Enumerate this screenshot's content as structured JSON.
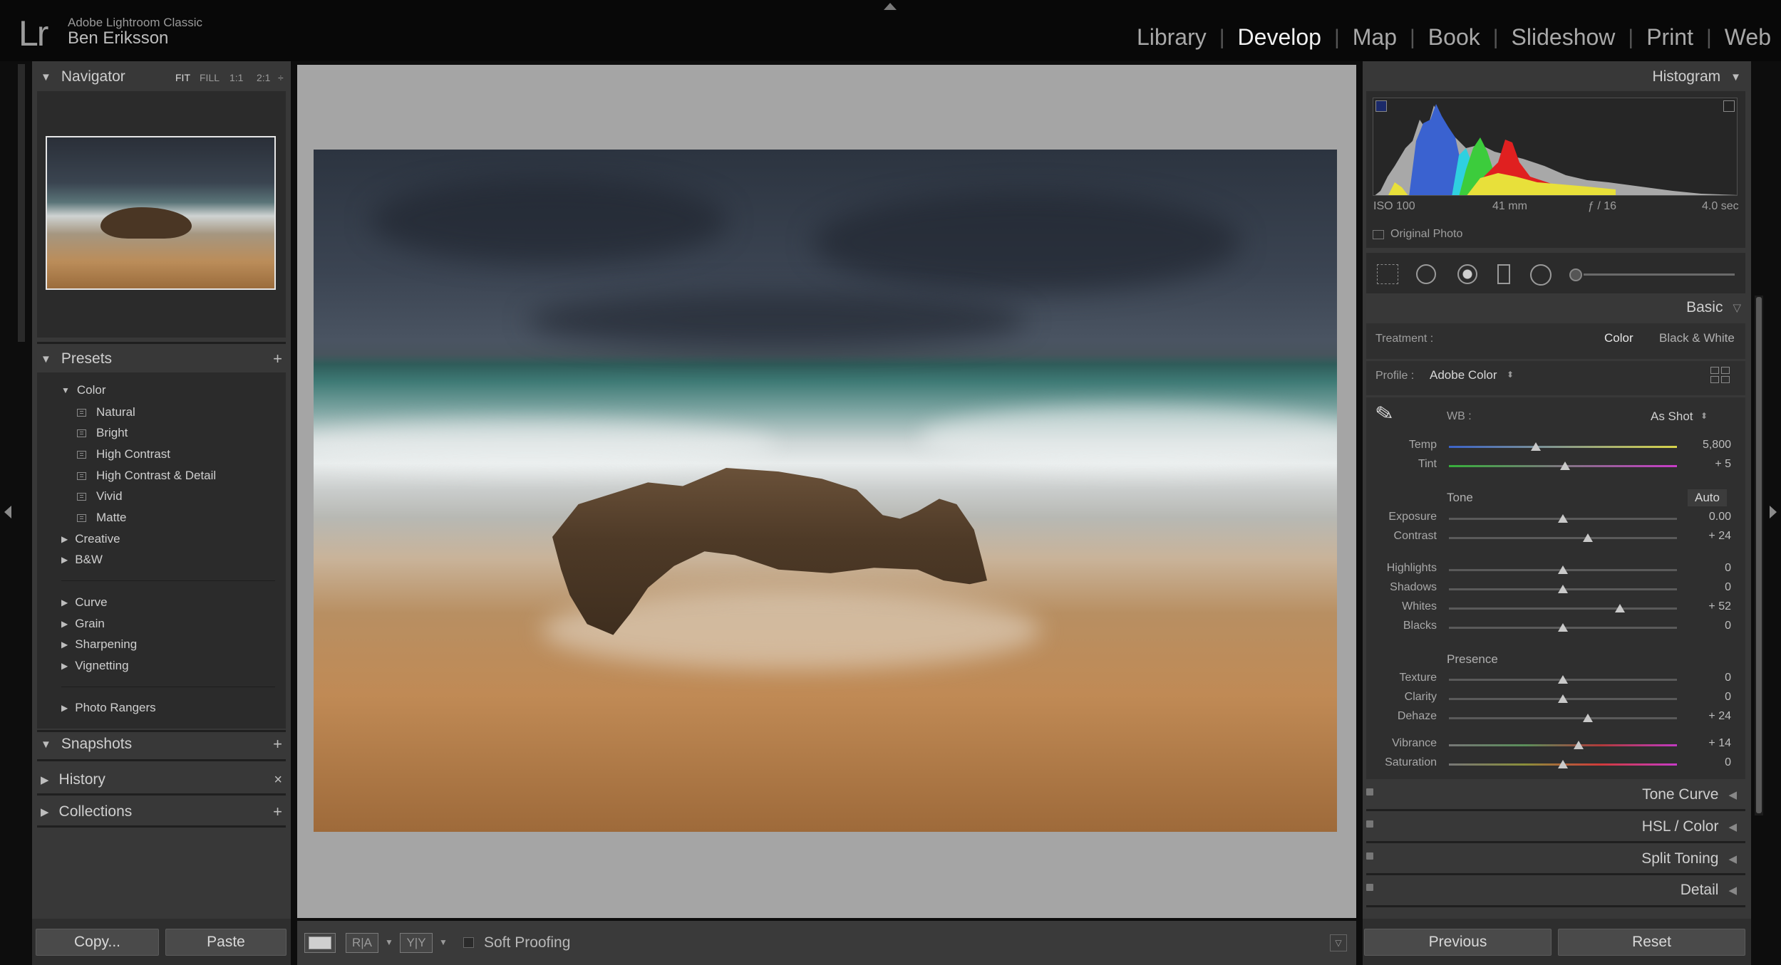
{
  "app": {
    "logo": "Lr",
    "name": "Adobe Lightroom Classic",
    "user": "Ben Eriksson"
  },
  "modules": [
    "Library",
    "Develop",
    "Map",
    "Book",
    "Slideshow",
    "Print",
    "Web"
  ],
  "active_module": "Develop",
  "navigator": {
    "title": "Navigator",
    "zoom_options": [
      "FIT",
      "FILL",
      "1:1",
      "2:1"
    ],
    "zoom_arrow": "÷"
  },
  "presets": {
    "title": "Presets",
    "add": "+",
    "color_group": "Color",
    "color_items": [
      "Natural",
      "Bright",
      "High Contrast",
      "High Contrast & Detail",
      "Vivid",
      "Matte"
    ],
    "groups_a": [
      "Creative",
      "B&W"
    ],
    "groups_b": [
      "Curve",
      "Grain",
      "Sharpening",
      "Vignetting"
    ],
    "groups_c": [
      "Photo Rangers"
    ]
  },
  "snapshots": {
    "title": "Snapshots",
    "action": "+"
  },
  "history": {
    "title": "History",
    "action": "×"
  },
  "collections": {
    "title": "Collections",
    "action": "+"
  },
  "left_buttons": {
    "copy": "Copy...",
    "paste": "Paste"
  },
  "toolbar": {
    "soft_proofing": "Soft Proofing",
    "ra_label": "R|A",
    "yy_label": "Y|Y"
  },
  "histogram": {
    "title": "Histogram",
    "iso": "ISO 100",
    "focal": "41 mm",
    "aperture": "ƒ / 16",
    "shutter": "4.0 sec",
    "original_photo": "Original Photo"
  },
  "basic": {
    "title": "Basic",
    "treatment_label": "Treatment :",
    "treatment_color": "Color",
    "treatment_bw": "Black & White",
    "profile_label": "Profile :",
    "profile_value": "Adobe Color",
    "wb_label": "WB :",
    "wb_value": "As Shot",
    "tone_label": "Tone",
    "auto_label": "Auto",
    "presence_label": "Presence",
    "sliders": [
      {
        "label": "Temp",
        "value": "5,800",
        "pos": 0.38
      },
      {
        "label": "Tint",
        "value": "+ 5",
        "pos": 0.51
      },
      {
        "label": "Exposure",
        "value": "0.00",
        "pos": 0.5
      },
      {
        "label": "Contrast",
        "value": "+ 24",
        "pos": 0.61
      },
      {
        "label": "Highlights",
        "value": "0",
        "pos": 0.5
      },
      {
        "label": "Shadows",
        "value": "0",
        "pos": 0.5
      },
      {
        "label": "Whites",
        "value": "+ 52",
        "pos": 0.75
      },
      {
        "label": "Blacks",
        "value": "0",
        "pos": 0.5
      },
      {
        "label": "Texture",
        "value": "0",
        "pos": 0.5
      },
      {
        "label": "Clarity",
        "value": "0",
        "pos": 0.5
      },
      {
        "label": "Dehaze",
        "value": "+ 24",
        "pos": 0.61
      },
      {
        "label": "Vibrance",
        "value": "+ 14",
        "pos": 0.57
      },
      {
        "label": "Saturation",
        "value": "0",
        "pos": 0.5
      }
    ]
  },
  "right_sections": [
    "Tone Curve",
    "HSL / Color",
    "Split Toning",
    "Detail"
  ],
  "right_buttons": {
    "previous": "Previous",
    "reset": "Reset"
  },
  "colors": {
    "panel": "#383838",
    "panel_dark": "#2b2b2b",
    "center_bg": "#a5a5a5",
    "active_module": "#f0f0f0"
  }
}
